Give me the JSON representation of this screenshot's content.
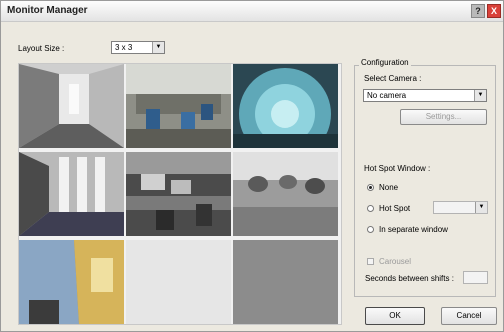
{
  "window": {
    "title": "Monitor Manager",
    "help_glyph": "?",
    "close_glyph": "X"
  },
  "layout": {
    "label": "Layout Size :",
    "value": "3 x 3"
  },
  "configuration": {
    "group_label": "Configuration",
    "select_camera_label": "Select Camera :",
    "camera_value": "No camera",
    "settings_button": "Settings...",
    "hotspot_label": "Hot Spot Window :",
    "options": [
      {
        "label": "None",
        "selected": true
      },
      {
        "label": "Hot Spot",
        "selected": false
      },
      {
        "label": "In separate window",
        "selected": false
      }
    ],
    "carousel_label": "Carousel",
    "seconds_label": "Seconds between shifts :",
    "seconds_value": ""
  },
  "buttons": {
    "ok": "OK",
    "cancel": "Cancel"
  },
  "cameras": [
    {
      "name": "corridor"
    },
    {
      "name": "office-blue-chairs"
    },
    {
      "name": "office-fisheye"
    },
    {
      "name": "hallway-windows"
    },
    {
      "name": "desk-office"
    },
    {
      "name": "dome-cameras"
    },
    {
      "name": "room-yellow-door"
    },
    {
      "name": "empty"
    },
    {
      "name": "empty-selected"
    }
  ]
}
